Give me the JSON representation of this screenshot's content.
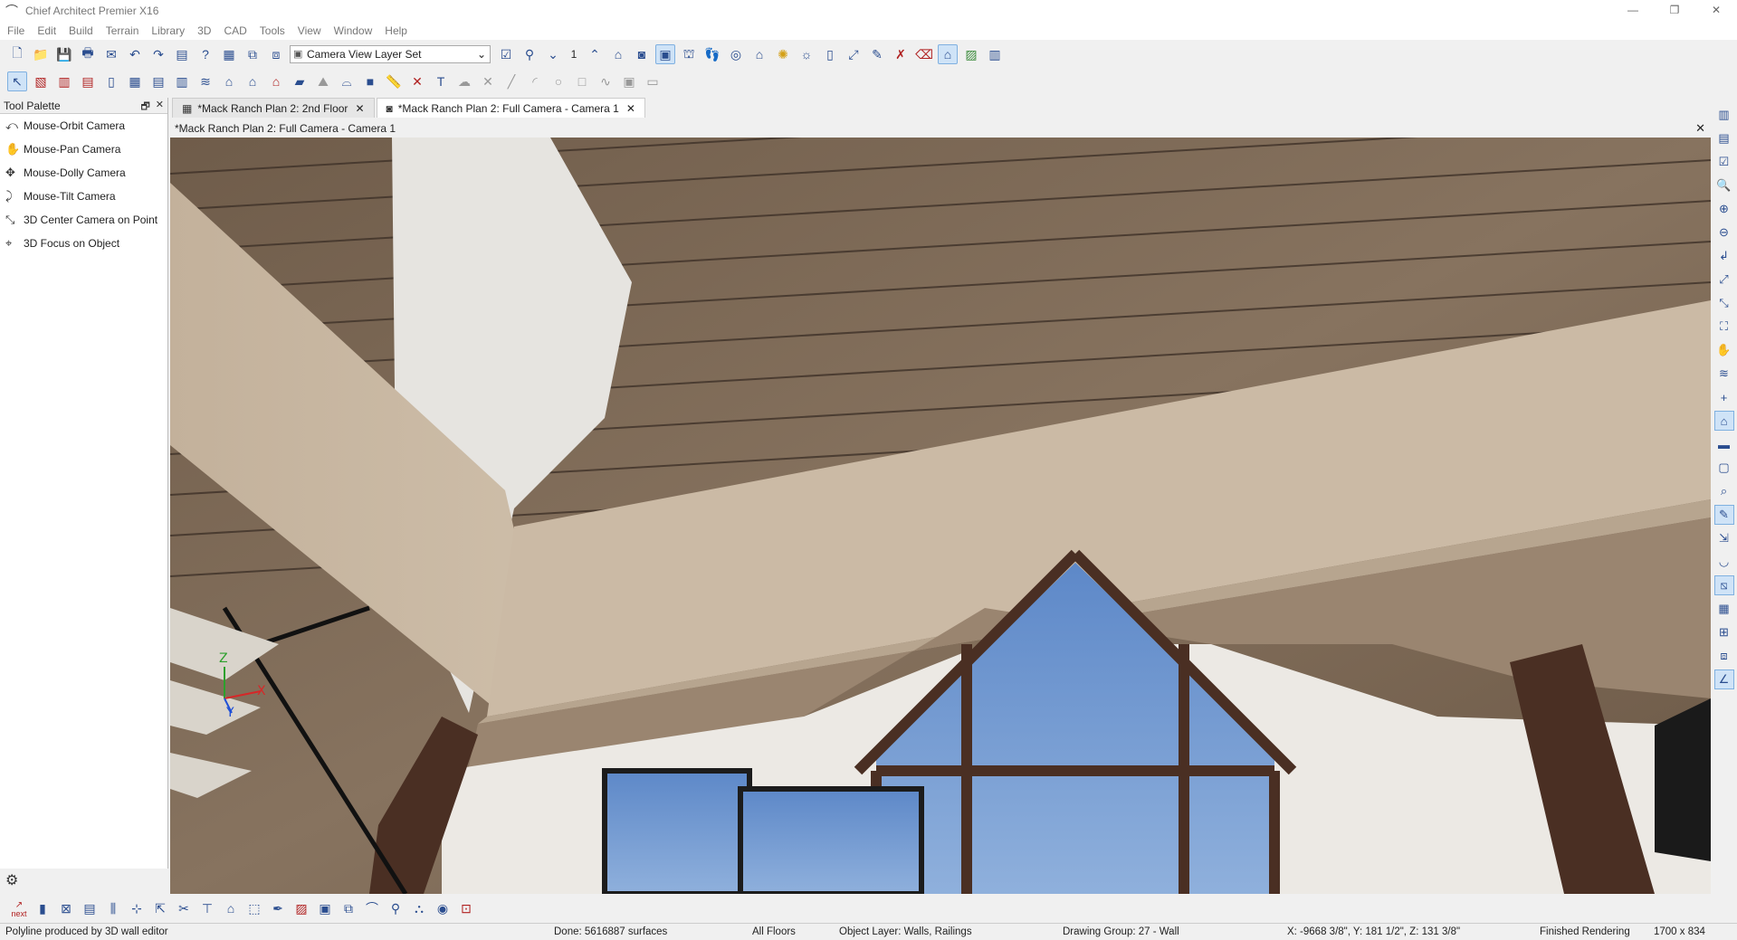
{
  "window": {
    "title": "Chief Architect Premier X16",
    "controls": [
      "—",
      "❐",
      "✕"
    ]
  },
  "menu": [
    "File",
    "Edit",
    "Build",
    "Terrain",
    "Library",
    "3D",
    "CAD",
    "Tools",
    "View",
    "Window",
    "Help"
  ],
  "toolbar1": {
    "buttons_left": [
      "new-document-icon",
      "open-folder-icon",
      "save-icon",
      "print-icon",
      "send-icon",
      "undo-icon",
      "redo-icon",
      "page-setup-icon",
      "help-icon",
      "layer-display-icon",
      "copy-layer-icon",
      "paste-layer-icon"
    ],
    "layer_set": "Camera View Layer Set",
    "floor_value": "1",
    "buttons_right": [
      "exterior-camera-icon",
      "camera-icon",
      "active-camera-icon",
      "elevation-icon",
      "walkthrough-icon",
      "orbit-icon",
      "house-icon",
      "light-icon",
      "sun-icon",
      "door-icon",
      "measure-icon",
      "edit-icon",
      "red-tool-icon",
      "red-eraser-icon",
      "plan-view-icon",
      "split-view-icon",
      "window-tile-icon"
    ]
  },
  "toolbar2": {
    "buttons": [
      "select-icon",
      "wall-icon",
      "railing-icon",
      "cabinet-icon",
      "door-tool-icon",
      "window-tool-icon",
      "stair-icon",
      "shelf-icon",
      "roof-icon",
      "house-tool-icon",
      "dormer-icon",
      "red-house-icon",
      "slab-icon",
      "terrain-icon",
      "arch-icon",
      "cube-icon",
      "ruler-icon",
      "dimension-icon",
      "text-icon",
      "cloud-icon",
      "cross-icon",
      "line-icon",
      "arc-icon",
      "circle-icon",
      "rectangle-icon",
      "spline-icon",
      "picture-icon",
      "cad-icon"
    ]
  },
  "palette": {
    "title": "Tool Palette",
    "items": [
      "Mouse-Orbit Camera",
      "Mouse-Pan Camera",
      "Mouse-Dolly Camera",
      "Mouse-Tilt Camera",
      "3D Center Camera on Point",
      "3D Focus on Object"
    ]
  },
  "tabs": [
    {
      "label": "*Mack Ranch Plan 2: 2nd Floor",
      "active": false
    },
    {
      "label": "*Mack Ranch Plan 2: Full Camera - Camera 1",
      "active": true
    }
  ],
  "view_title": "*Mack Ranch Plan 2: Full Camera - Camera 1",
  "axes": {
    "x": "X",
    "y": "Y",
    "z": "Z"
  },
  "bottom_toolbar": {
    "next_label": "next"
  },
  "status": {
    "message": "Polyline produced by 3D wall editor",
    "done": "Done:  5616887 surfaces",
    "floors": "All Floors",
    "object_layer": "Object Layer: Walls,  Railings",
    "drawing_group": "Drawing Group: 27 - Wall",
    "coords": "X: -9668 3/8\", Y: 181 1/2\", Z: 131 3/8\"",
    "render": "Finished Rendering",
    "size": "1700 x 834"
  },
  "colors": {
    "ceiling_wood": "#7d6a58",
    "beam": "#c8b7a2",
    "white_trim": "#e4e2de",
    "wall": "#ece9e4",
    "sky": "#6f95cf",
    "dark_wood": "#4a2f23",
    "accent_blue": "#2a4d8f"
  }
}
